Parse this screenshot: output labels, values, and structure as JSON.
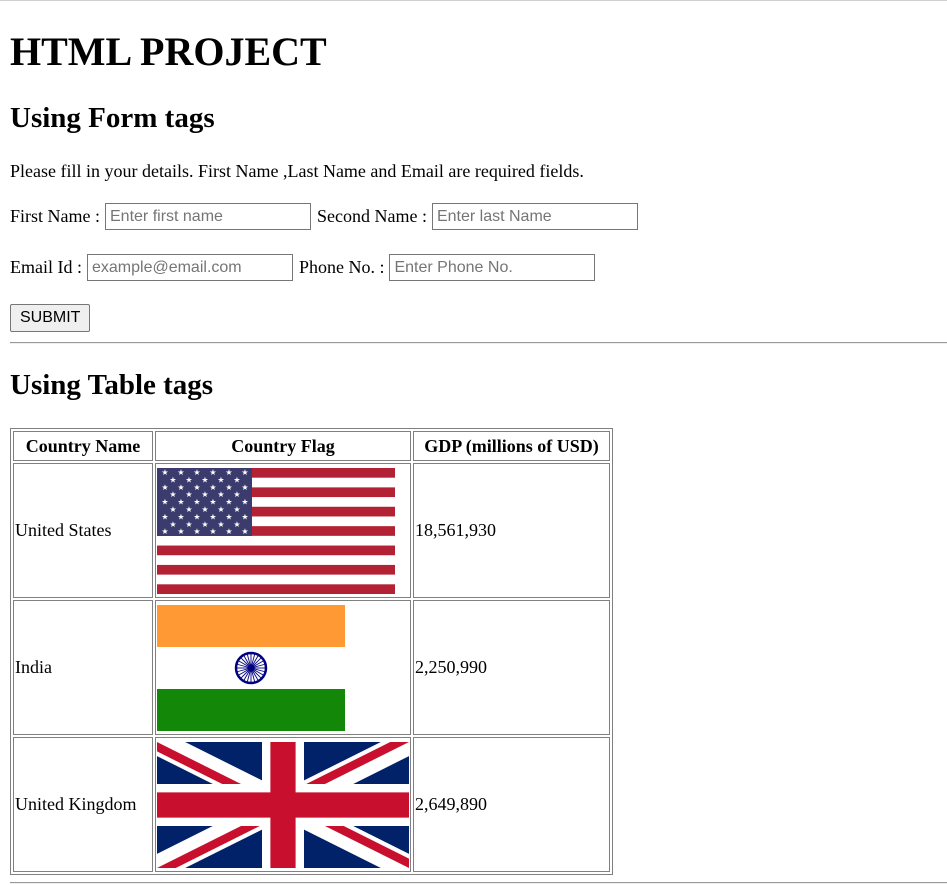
{
  "title": "HTML PROJECT",
  "form_section": {
    "heading": "Using Form tags",
    "intro": "Please fill in your details. First Name ,Last Name and Email are required fields.",
    "first_name_label": "First Name :",
    "first_name_placeholder": "Enter first name",
    "second_name_label": "Second Name :",
    "second_name_placeholder": "Enter last Name",
    "email_label": "Email Id :",
    "email_placeholder": "example@email.com",
    "phone_label": "Phone No. :",
    "phone_placeholder": "Enter Phone No.",
    "submit_label": "SUBMIT"
  },
  "table_section": {
    "heading": "Using Table tags",
    "headers": [
      "Country Name",
      "Country Flag",
      "GDP (millions of USD)"
    ],
    "rows": [
      {
        "country": "United States",
        "flag": "us-flag",
        "gdp": "18,561,930"
      },
      {
        "country": "India",
        "flag": "india-flag",
        "gdp": "2,250,990"
      },
      {
        "country": "United Kingdom",
        "flag": "uk-flag",
        "gdp": "2,649,890"
      }
    ]
  },
  "colors": {
    "us_red": "#B22234",
    "us_blue": "#3C3B6E",
    "india_saffron": "#FF9933",
    "india_green": "#138808",
    "india_chakra": "#000080",
    "uk_blue": "#012169",
    "uk_red": "#C8102E"
  }
}
